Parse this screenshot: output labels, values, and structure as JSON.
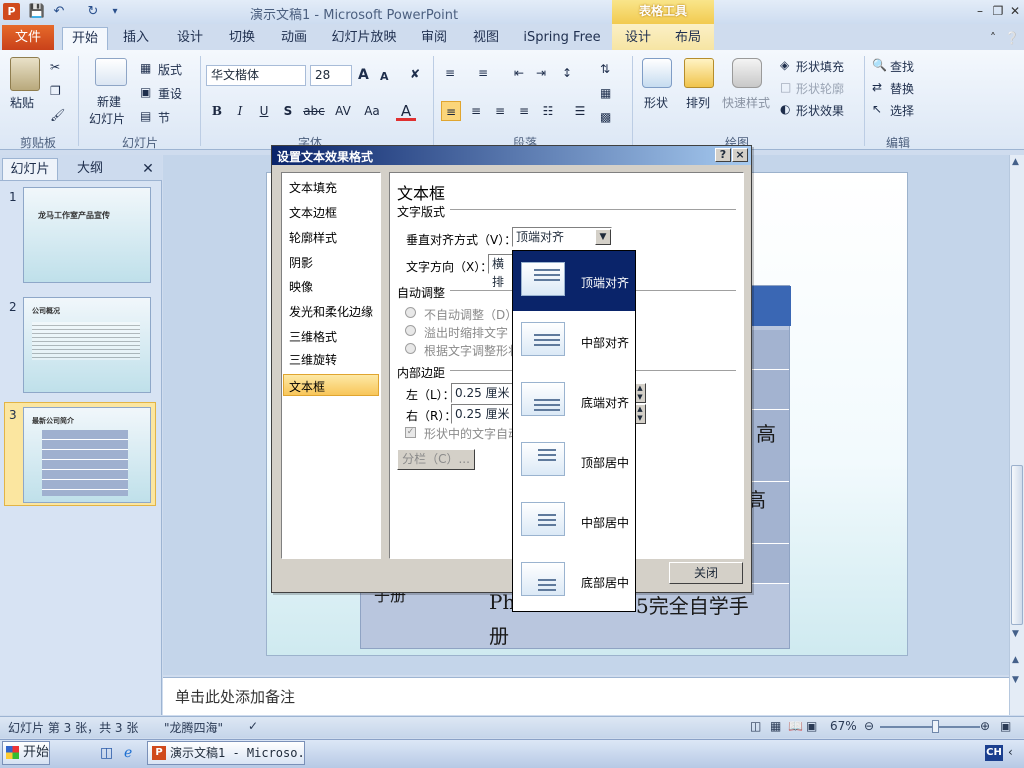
{
  "window": {
    "title": "演示文稿1 - Microsoft PowerPoint",
    "context_group": "表格工具"
  },
  "quick_access": {
    "app_icon": "P",
    "save": "save-icon",
    "undo": "undo-icon",
    "redo": "redo-icon"
  },
  "ribbon_tabs": {
    "file": "文件",
    "home": "开始",
    "insert": "插入",
    "design": "设计",
    "transitions": "切换",
    "animations": "动画",
    "slideshow": "幻灯片放映",
    "review": "审阅",
    "view": "视图",
    "ispring": "iSpring Free",
    "table_design": "设计",
    "table_layout": "布局"
  },
  "ribbon": {
    "clipboard": {
      "paste": "粘贴",
      "label": "剪贴板"
    },
    "slides": {
      "new_slide_1": "新建",
      "new_slide_2": "幻灯片",
      "layout": "版式",
      "reset": "重设",
      "section": "节",
      "label": "幻灯片"
    },
    "font": {
      "name": "华文楷体",
      "size": "28",
      "grow": "A",
      "shrink": "A",
      "bold": "B",
      "italic": "I",
      "underline": "U",
      "shadow": "S",
      "strike": "abc",
      "spacing": "AV",
      "case": "Aa",
      "color": "A",
      "label": "字体"
    },
    "paragraph": {
      "label": "段落"
    },
    "drawing": {
      "shapes": "形状",
      "arrange": "排列",
      "quick_styles": "快速样式",
      "shape_fill": "形状填充",
      "shape_outline": "形状轮廓",
      "shape_effects": "形状效果",
      "label": "绘图"
    },
    "editing": {
      "find": "查找",
      "replace": "替换",
      "select": "选择",
      "label": "编辑"
    }
  },
  "left_pane": {
    "tabs": {
      "slides": "幻灯片",
      "outline": "大纲"
    },
    "thumbnails": [
      {
        "num": "1",
        "title": "龙马工作室产品宣传"
      },
      {
        "num": "2",
        "title": "公司概况"
      },
      {
        "num": "3",
        "title": "最新公司简介"
      }
    ]
  },
  "slide": {
    "cell_text_1": "高",
    "cell_text_2": "高",
    "cell_text_3": "子册",
    "cell_text_4": "Ph",
    "cell_text_5": "5完全自学手",
    "cell_text_6": "册"
  },
  "notes": {
    "placeholder": "单击此处添加备注"
  },
  "status": {
    "slide_info": "幻灯片 第 3 张，共 3 张",
    "theme": "\"龙腾四海\"",
    "zoom": "67%",
    "zoom_level": 0.55
  },
  "taskbar": {
    "start": "开始",
    "ppt_task": "演示文稿1 - Microso...",
    "ime": "CH"
  },
  "dialog": {
    "title": "设置文本效果格式",
    "help": "?",
    "close_x": "×",
    "nav": [
      "文本填充",
      "文本边框",
      "轮廓样式",
      "阴影",
      "映像",
      "发光和柔化边缘",
      "三维格式",
      "三维旋转",
      "文本框"
    ],
    "nav_selected_index": 8,
    "heading": "文本框",
    "section_layout": "文字版式",
    "valign_label": "垂直对齐方式（V）：",
    "valign_value": "顶端对齐",
    "direction_label": "文字方向（X）：",
    "direction_value": "横排",
    "section_autofit": "自动调整",
    "autofit_options": [
      "不自动调整（D）",
      "溢出时缩排文字",
      "根据文字调整形状"
    ],
    "section_margins": "内部边距",
    "margin_left_label": "左（L）：",
    "margin_left_value": "0.25 厘米",
    "margin_right_label": "右（R）：",
    "margin_right_value": "0.25 厘米",
    "wrap_checkbox": "形状中的文字自动",
    "columns_button": "分栏（C）...",
    "close_button": "关闭"
  },
  "valign_dropdown": {
    "options": [
      "顶端对齐",
      "中部对齐",
      "底端对齐",
      "顶部居中",
      "中部居中",
      "底部居中"
    ],
    "selected_index": 0
  }
}
